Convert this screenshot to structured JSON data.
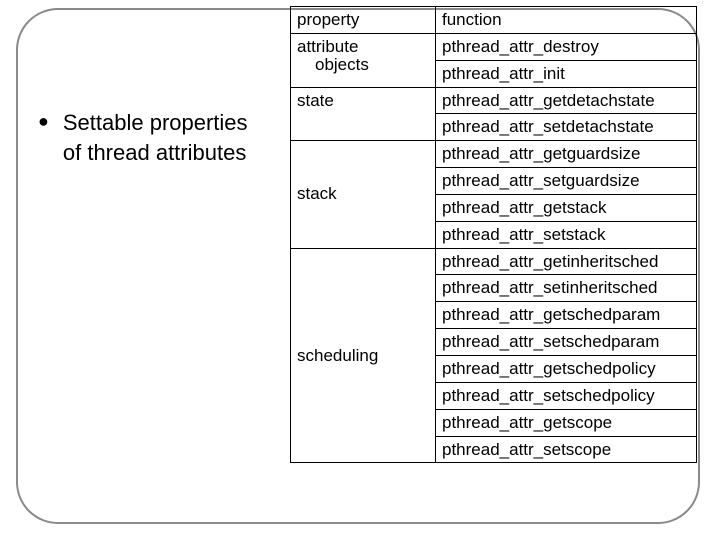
{
  "bullet": {
    "text": "Settable properties of thread attributes"
  },
  "table": {
    "header": {
      "property": "property",
      "function": "function"
    },
    "rows": [
      {
        "property_line1": "attribute",
        "property_line2": "objects",
        "functions": [
          "pthread_attr_destroy",
          "pthread_attr_init"
        ]
      },
      {
        "property": "state",
        "functions": [
          "pthread_attr_getdetachstate",
          "pthread_attr_setdetachstate"
        ]
      },
      {
        "property": "stack",
        "functions": [
          "pthread_attr_getguardsize",
          "pthread_attr_setguardsize",
          "pthread_attr_getstack",
          "pthread_attr_setstack"
        ]
      },
      {
        "property": "scheduling",
        "functions": [
          "pthread_attr_getinheritsched",
          "pthread_attr_setinheritsched",
          "pthread_attr_getschedparam",
          "pthread_attr_setschedparam",
          "pthread_attr_getschedpolicy",
          "pthread_attr_setschedpolicy",
          "pthread_attr_getscope",
          "pthread_attr_setscope"
        ]
      }
    ]
  }
}
